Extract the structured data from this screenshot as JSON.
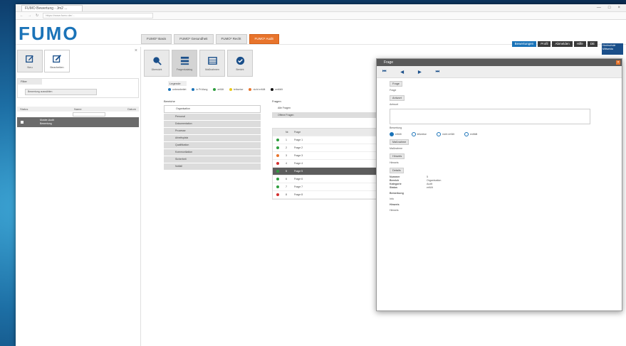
{
  "browser": {
    "tab_title": "FUMO Bewertung - Jm2 ...",
    "url": "https://www.fumo.de/...",
    "window_controls": [
      "—",
      "□",
      "×"
    ]
  },
  "app": {
    "logo": "FUMO",
    "modules": [
      {
        "label": "FUMO* Basis",
        "active": false
      },
      {
        "label": "FUMO* Gesundheit",
        "active": false
      },
      {
        "label": "FUMO* Recht",
        "active": false
      },
      {
        "label": "FUMO* Audit",
        "active": true
      }
    ],
    "top_right": [
      {
        "label": "Bewertungen",
        "blue": true
      },
      {
        "label": "Profil",
        "blue": false
      },
      {
        "label": "Abmelden",
        "blue": false
      },
      {
        "label": "Hilfe",
        "blue": false
      },
      {
        "label": "DE",
        "blue": false
      }
    ],
    "brand_box": "Hochschule Mittweida"
  },
  "left_panel": {
    "tools": [
      {
        "label": "Neu",
        "active": false
      },
      {
        "label": "Bearbeiten",
        "active": true
      }
    ],
    "box_header": "Filter",
    "box_button": "Bewertung auswählen",
    "columns": [
      "Status",
      "Name",
      "Datum"
    ],
    "rows": [
      {
        "line1": "Muster-Audit",
        "line2": "Bewertung"
      }
    ]
  },
  "main": {
    "view_tabs": [
      {
        "label": "Übersicht",
        "active": false
      },
      {
        "label": "Fragenkatalog",
        "active": true
      },
      {
        "label": "Maßnahmen",
        "active": false
      },
      {
        "label": "Bericht",
        "active": false
      }
    ],
    "legend_title": "Legende",
    "legend_items": [
      {
        "label": "unbearbeitet",
        "color": "#1a73b8"
      },
      {
        "label": "in Prüfung",
        "color": "#1a73b8"
      },
      {
        "label": "erfüllt",
        "color": "#2e9e3e"
      },
      {
        "label": "teilweise",
        "color": "#e8c81a"
      },
      {
        "label": "nicht erfüllt",
        "color": "#e8742c"
      },
      {
        "label": "entfällt",
        "color": "#111111"
      }
    ],
    "sections_title": "Bereiche",
    "sections": [
      {
        "label": "Organisation",
        "selected": true
      },
      {
        "label": "Personal",
        "selected": false
      },
      {
        "label": "Dokumentation",
        "selected": false
      },
      {
        "label": "Prozesse",
        "selected": false
      },
      {
        "label": "Arbeitsplatz",
        "selected": false
      },
      {
        "label": "Qualifikation",
        "selected": false
      },
      {
        "label": "Kommunikation",
        "selected": false
      },
      {
        "label": "Sicherheit",
        "selected": false
      },
      {
        "label": "Notfall",
        "selected": false
      }
    ],
    "questions_title": "Fragen",
    "question_bars": [
      {
        "label": "Alle Fragen",
        "grey": false
      },
      {
        "label": "Offene Fragen",
        "grey": true
      }
    ],
    "questions": [
      {
        "num": "Nr.",
        "text": "Frage",
        "color": "",
        "header": true,
        "selected": false
      },
      {
        "num": "1",
        "text": "Frage 1",
        "color": "#2e9e3e",
        "header": false,
        "selected": false
      },
      {
        "num": "2",
        "text": "Frage 2",
        "color": "#2e9e3e",
        "header": false,
        "selected": false
      },
      {
        "num": "3",
        "text": "Frage 3",
        "color": "#e8742c",
        "header": false,
        "selected": false
      },
      {
        "num": "4",
        "text": "Frage 4",
        "color": "#d32f2f",
        "header": false,
        "selected": false
      },
      {
        "num": "5",
        "text": "Frage 5",
        "color": "#2e9e3e",
        "header": false,
        "selected": true
      },
      {
        "num": "6",
        "text": "Frage 6",
        "color": "#2e9e3e",
        "header": false,
        "selected": false
      },
      {
        "num": "7",
        "text": "Frage 7",
        "color": "#2e9e3e",
        "header": false,
        "selected": false
      },
      {
        "num": "8",
        "text": "Frage 8",
        "color": "#d32f2f",
        "header": false,
        "selected": false
      }
    ]
  },
  "dialog": {
    "title": "Frage",
    "close": "×",
    "nav": [
      "⏮",
      "◀",
      "▶",
      "⏭"
    ],
    "question_header": "Frage",
    "question_text": "Frage",
    "answer_header": "Antwort",
    "answer_label": "Antwort",
    "rating_label": "Bewertung",
    "ratings": [
      {
        "label": "erfüllt",
        "on": true
      },
      {
        "label": "teilweise",
        "on": false
      },
      {
        "label": "nicht erfüllt",
        "on": false
      },
      {
        "label": "entfällt",
        "on": false
      }
    ],
    "measure_header": "Maßnahme",
    "measure_text": "Maßnahme",
    "comment_header": "Hinweis",
    "comment_text": "Hinweis",
    "details_header": "Details",
    "details": [
      {
        "k": "Nummer",
        "v": "5"
      },
      {
        "k": "Bereich",
        "v": "Organisation"
      },
      {
        "k": "Kategorie",
        "v": "Audit"
      },
      {
        "k": "Status",
        "v": "erfüllt"
      }
    ],
    "notes_title": "Bemerkung",
    "notes_sub": "Info",
    "notes_label": "Hinweis",
    "notes_text": "Hinweis"
  }
}
